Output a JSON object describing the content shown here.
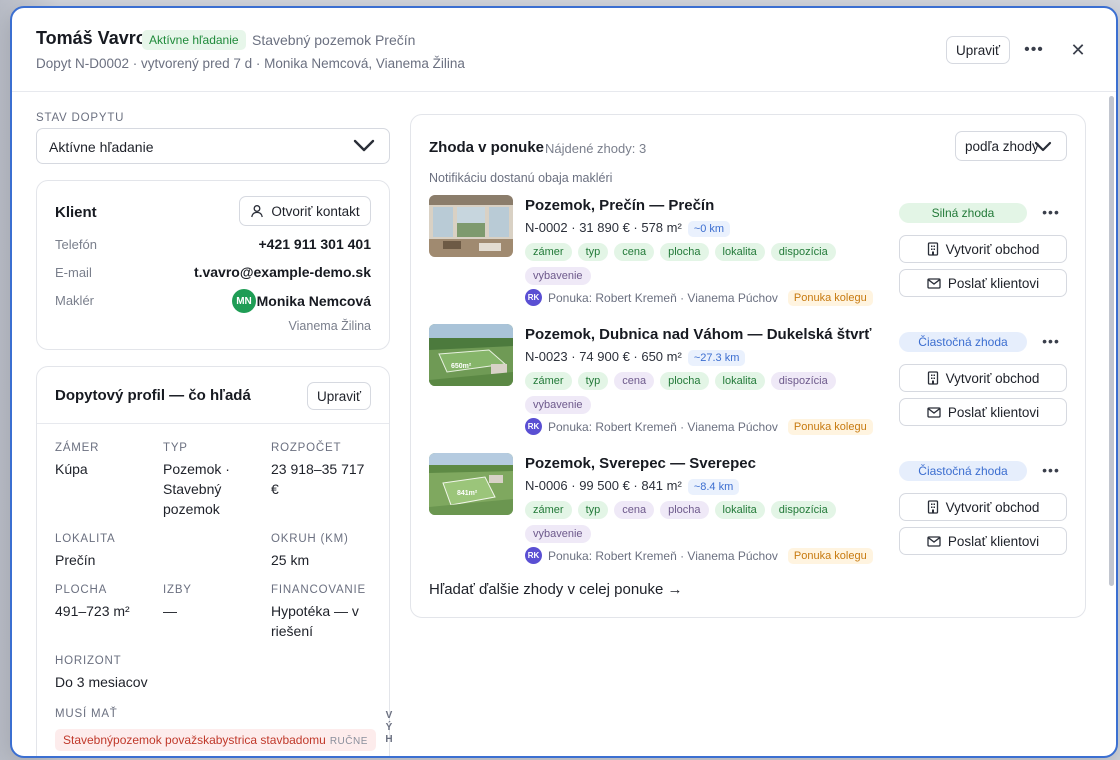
{
  "header": {
    "name": "Tomáš Vavro",
    "status_badge": "Aktívne hľadanie",
    "topic": "Stavebný pozemok Prečín",
    "subtitle": "Dopyt N-D0002 · vytvorený pred 7 d · Monika Nemcová, Vianema Žilina",
    "edit_label": "Upraviť",
    "more_icon": "more-horizontal-icon",
    "close_icon": "close-icon"
  },
  "status_section": {
    "label": "STAV DOPYTU",
    "value": "Aktívne hľadanie"
  },
  "client": {
    "title": "Klient",
    "open_contact_label": "Otvoriť kontakt",
    "phone_label": "Telefón",
    "phone": "+421 911 301 401",
    "email_label": "E-mail",
    "email": "t.vavro@example-demo.sk",
    "broker_label": "Maklér",
    "broker_initials": "MN",
    "broker_name": "Monika Nemcová",
    "broker_agency": "Vianema Žilina"
  },
  "profile": {
    "title": "Dopytový profil — čo hľadá",
    "edit_label": "Upraviť",
    "fields": {
      "zamer_label": "ZÁMER",
      "zamer": "Kúpa",
      "typ_label": "TYP",
      "typ_1": "Pozemok ·",
      "typ_2": "Stavebný",
      "typ_3": "pozemok",
      "rozpocet_label": "ROZPOČET",
      "rozpocet_1": "23 918–35 717",
      "rozpocet_2": "€",
      "lokalita_label": "LOKALITA",
      "lokalita": "Prečín",
      "okruh_label": "OKRUH (KM)",
      "okruh": "25 km",
      "plocha_label": "PLOCHA",
      "plocha": "491–723 m²",
      "izby_label": "IZBY",
      "izby": "—",
      "financovanie_label": "FINANCOVANIE",
      "financovanie_1": "Hypotéka — v",
      "financovanie_2": "riešení",
      "horizont_label": "HORIZONT",
      "horizont": "Do 3 mesiacov",
      "musi_label": "MUSÍ MAŤ",
      "musi_tag": "Stavebnýpozemok považskabystrica stavbadomu",
      "musi_manual": "RUČNE"
    },
    "side_letters": [
      "V",
      "Ý",
      "H"
    ]
  },
  "matches": {
    "title": "Zhoda v ponuke",
    "count": "Nájdené zhody: 3",
    "sort_label": "podľa zhody",
    "note": "Notifikáciu dostanú obaja makléri",
    "create_label": "Vytvoriť obchod",
    "send_label": "Poslať klientovi",
    "more_link": "Hľadať ďalšie zhody v celej ponuke →",
    "items": [
      {
        "title": "Pozemok, Prečín — Prečín",
        "meta": "N-0002 · 31 890 € · 578 m²",
        "distance": "~0 km",
        "status": "Silná zhoda",
        "chips": [
          "zámer",
          "typ",
          "cena",
          "plocha",
          "lokalita",
          "dispozícia",
          "vybavenie"
        ],
        "offer": "Ponuka: Robert Kremeň · Vianema Púchov",
        "offer_initials": "RK",
        "colleague": "Ponuka kolegu"
      },
      {
        "title": "Pozemok, Dubnica nad Váhom — Dukelská štvrť",
        "meta": "N-0023 · 74 900 € · 650 m²",
        "distance": "~27.3 km",
        "status": "Čiastočná zhoda",
        "chips": [
          "zámer",
          "typ",
          "cena",
          "plocha",
          "lokalita",
          "dispozícia",
          "vybavenie"
        ],
        "offer": "Ponuka: Robert Kremeň · Vianema Púchov",
        "offer_initials": "RK",
        "colleague": "Ponuka kolegu",
        "thumb_text": "650m²"
      },
      {
        "title": "Pozemok, Sverepec — Sverepec",
        "meta": "N-0006 · 99 500 € · 841 m²",
        "distance": "~8.4 km",
        "status": "Čiastočná zhoda",
        "chips": [
          "zámer",
          "typ",
          "cena",
          "plocha",
          "lokalita",
          "dispozícia",
          "vybavenie"
        ],
        "offer": "Ponuka: Robert Kremeň · Vianema Púchov",
        "offer_initials": "RK",
        "colleague": "Ponuka kolegu",
        "thumb_text": "841m²"
      }
    ]
  }
}
